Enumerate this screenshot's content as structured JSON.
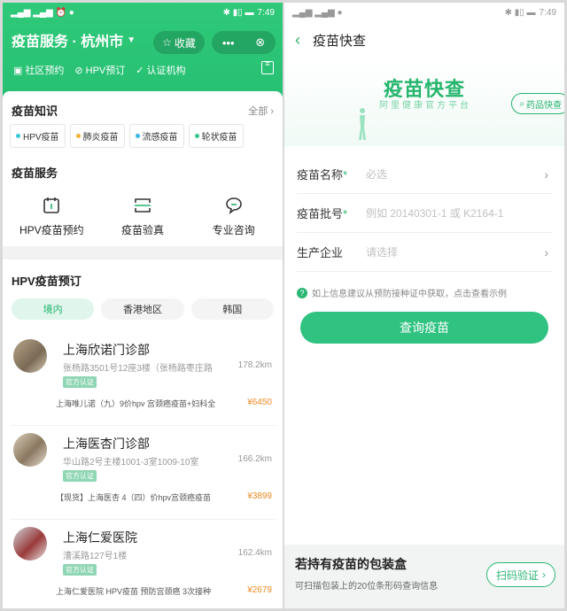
{
  "left": {
    "status": {
      "time": "7:49"
    },
    "header": {
      "title": "疫苗服务 · 杭州市",
      "fav_label": "收藏",
      "more": "•••",
      "links": [
        "社区预约",
        "HPV预订",
        "认证机构"
      ]
    },
    "knowledge": {
      "title": "疫苗知识",
      "all_label": "全部",
      "chips": [
        {
          "label": "HPV疫苗",
          "color": "#3cc8d8"
        },
        {
          "label": "肺炎疫苗",
          "color": "#f2b233"
        },
        {
          "label": "流感疫苗",
          "color": "#3bb7e6"
        },
        {
          "label": "轮状疫苗",
          "color": "#38c98a"
        }
      ]
    },
    "services": {
      "title": "疫苗服务",
      "items": [
        {
          "label": "HPV疫苗预约",
          "icon": "calendar-icon"
        },
        {
          "label": "疫苗验真",
          "icon": "scan-icon"
        },
        {
          "label": "专业咨询",
          "icon": "chat-icon"
        }
      ]
    },
    "hpv": {
      "title": "HPV疫苗预订",
      "tabs": [
        "境内",
        "香港地区",
        "韩国"
      ],
      "clinics": [
        {
          "name": "上海欣诺门诊部",
          "address": "张杨路3501号12座3楼（张杨路枣庄路",
          "distance": "178.2km",
          "badge": "官方认证",
          "product": "上海唯儿诺（九）9价hpv 宫颈癌疫苗+妇科全",
          "price": "¥6450"
        },
        {
          "name": "上海医杏门诊部",
          "address": "华山路2号主楼1001-3室1009-10室",
          "distance": "166.2km",
          "badge": "官方认证",
          "product": "【现货】上海医杏 4（四）价hpv宫颈癌疫苗",
          "price": "¥3899"
        },
        {
          "name": "上海仁爱医院",
          "address": "漕溪路127号1楼",
          "distance": "162.4km",
          "badge": "官方认证",
          "product": "上海仁爱医院 HPV疫苗 预防宫颈癌 3次接种",
          "price": "¥2679"
        }
      ]
    }
  },
  "right": {
    "status": {
      "time": "7:49"
    },
    "header": {
      "title": "疫苗快查"
    },
    "hero": {
      "title": "疫苗快查",
      "subtitle": "阿里健康官方平台",
      "drug_btn": "药品快查"
    },
    "form": {
      "name_label": "疫苗名称",
      "name_placeholder": "必选",
      "batch_label": "疫苗批号",
      "batch_placeholder": "例如 20140301-1 或 K2164-1",
      "maker_label": "生产企业",
      "maker_placeholder": "请选择",
      "req": "*"
    },
    "hint": "如上信息建议从预防接种证中获取，点击查看示例",
    "query_button": "查询疫苗",
    "bottom": {
      "title": "若持有疫苗的包装盒",
      "subtitle": "可扫描包装上的20位条形码查询信息",
      "scan_button": "扫码验证"
    }
  }
}
